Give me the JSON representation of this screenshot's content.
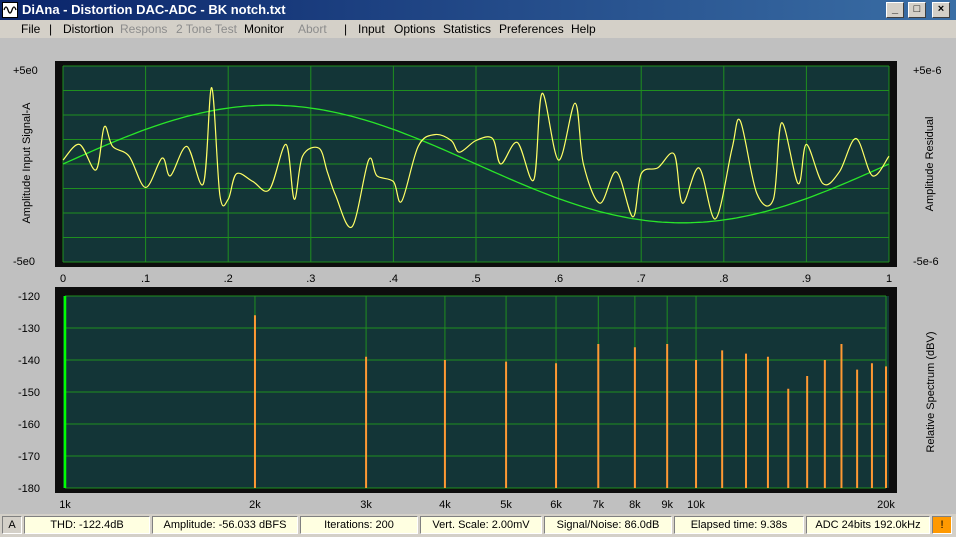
{
  "window": {
    "title": "DiAna - Distortion DAC-ADC - BK notch.txt"
  },
  "titlebar_buttons": [
    "_",
    "□",
    "×"
  ],
  "menu": {
    "items": [
      {
        "label": "File",
        "enabled": true
      },
      {
        "label": "Distortion",
        "enabled": true
      },
      {
        "label": "Respons",
        "enabled": false
      },
      {
        "label": "2 Tone Test",
        "enabled": false
      },
      {
        "label": "Monitor",
        "enabled": true
      },
      {
        "label": "Abort",
        "enabled": false
      },
      {
        "label": "Input",
        "enabled": true
      },
      {
        "label": "Options",
        "enabled": true
      },
      {
        "label": "Statistics",
        "enabled": true
      },
      {
        "label": "Preferences",
        "enabled": true
      },
      {
        "label": "Help",
        "enabled": true
      }
    ],
    "separator": "|"
  },
  "top_plot": {
    "y_left_top": "+5e0",
    "y_left_bottom": "-5e0",
    "y_right_top": "+5e-6",
    "y_right_bottom": "-5e-6",
    "y_left_label": "Amplitude Input Signal-A",
    "y_right_label": "Amplitude Residual",
    "x_ticks": [
      "0",
      ".1",
      ".2",
      ".3",
      ".4",
      ".5",
      ".6",
      ".7",
      ".8",
      ".9",
      "1"
    ]
  },
  "bottom_plot": {
    "y_ticks": [
      "-120",
      "-130",
      "-140",
      "-150",
      "-160",
      "-170",
      "-180"
    ],
    "y_right_label": "Relative Spectrum (dBV)",
    "x_tick_labels": [
      "1k",
      "2k",
      "3k",
      "4k",
      "5k",
      "6k",
      "7k",
      "8k",
      "9k",
      "10k",
      "20k"
    ]
  },
  "chart_data": [
    {
      "type": "line",
      "series": [],
      "xlim": [
        0,
        1
      ],
      "ylim": [
        -5,
        5
      ],
      "grid": true,
      "note_series": "green sine (input signal, one period) and yellow residual trace",
      "sine": {
        "amplitude": 3.0,
        "phase_periods": 0.0
      },
      "residual_x": [
        0,
        0.02,
        0.04,
        0.05,
        0.06,
        0.08,
        0.1,
        0.12,
        0.13,
        0.15,
        0.17,
        0.18,
        0.19,
        0.2,
        0.21,
        0.23,
        0.25,
        0.27,
        0.28,
        0.29,
        0.31,
        0.32,
        0.33,
        0.35,
        0.37,
        0.38,
        0.4,
        0.41,
        0.43,
        0.45,
        0.47,
        0.48,
        0.5,
        0.52,
        0.53,
        0.55,
        0.57,
        0.58,
        0.6,
        0.62,
        0.63,
        0.65,
        0.67,
        0.69,
        0.7,
        0.72,
        0.74,
        0.75,
        0.77,
        0.79,
        0.81,
        0.82,
        0.84,
        0.86,
        0.87,
        0.89,
        0.9,
        0.92,
        0.94,
        0.96,
        0.98,
        1
      ],
      "residual_y": [
        0.2,
        1.0,
        -0.3,
        1.9,
        0.9,
        0.4,
        -1.2,
        0.3,
        -0.6,
        0.9,
        -1.0,
        3.9,
        -1.6,
        -1.8,
        -0.5,
        -0.9,
        -1.3,
        1.0,
        -1.8,
        0.4,
        0.8,
        -0.4,
        -1.6,
        -3.2,
        0.2,
        -0.6,
        -0.9,
        -1.9,
        0.9,
        1.5,
        1.2,
        0.6,
        1.2,
        1.3,
        0.0,
        1.1,
        -0.8,
        3.6,
        0.2,
        3.1,
        0.0,
        -2.0,
        -0.4,
        -2.7,
        -0.5,
        -0.2,
        0.5,
        -2.0,
        -0.2,
        -2.8,
        0.8,
        2.2,
        -1.5,
        -1.8,
        2.1,
        -1.0,
        1.0,
        -1.0,
        -0.4,
        1.3,
        -0.6,
        0.4
      ]
    },
    {
      "type": "bar",
      "x_scale": "log",
      "xlim": [
        1000,
        20000
      ],
      "ylim": [
        -180,
        -120
      ],
      "grid": true,
      "x": [
        1000,
        2000,
        3000,
        4000,
        5000,
        6000,
        7000,
        8000,
        9000,
        10000,
        11000,
        12000,
        13000,
        14000,
        15000,
        16000,
        17000,
        18000,
        19000,
        20000
      ],
      "values": [
        -120,
        -126,
        -139,
        -140,
        -140.5,
        -141,
        -135,
        -136,
        -135,
        -140,
        -137,
        -138,
        -139,
        -149,
        -145,
        -140,
        -135,
        -143,
        -141,
        -142
      ]
    }
  ],
  "status": {
    "channel": "A",
    "thd": "THD: -122.4dB",
    "amplitude": "Amplitude: -56.033 dBFS",
    "iterations": "Iterations: 200",
    "vert_scale": "Vert. Scale: 2.00mV",
    "snr": "Signal/Noise:   86.0dB",
    "elapsed": "Elapsed time: 9.38s",
    "adc": "ADC 24bits 192.0kHz",
    "warn": "!"
  },
  "colors": {
    "plot_bg": "#133537",
    "grid": "#1f8f1f",
    "sine": "#29e629",
    "residual": "#ffff66",
    "bars": "#ff9933",
    "fundamental": "#00ff00",
    "label_blue": "#1a1a6e"
  }
}
